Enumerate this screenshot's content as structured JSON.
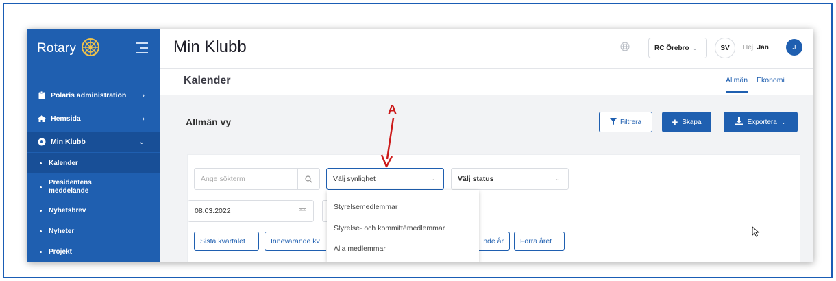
{
  "brand": {
    "name": "Rotary",
    "color": "#1f5fb0"
  },
  "sidebar": {
    "items": [
      {
        "label": "Polaris administration",
        "icon": "clipboard-icon",
        "arrow": "›"
      },
      {
        "label": "Hemsida",
        "icon": "home-icon",
        "arrow": "›"
      },
      {
        "label": "Min Klubb",
        "icon": "rotary-wheel-icon",
        "arrow": "⌄"
      }
    ],
    "subitems": [
      {
        "label": "Kalender"
      },
      {
        "label_line1": "Presidentens",
        "label_line2": "meddelande"
      },
      {
        "label": "Nyhetsbrev"
      },
      {
        "label": "Nyheter"
      },
      {
        "label": "Projekt"
      }
    ]
  },
  "header": {
    "title": "Min Klubb",
    "club": "RC Örebro",
    "language": "SV",
    "greeting_prefix": "Hej,",
    "user_name": "Jan",
    "avatar_initial": "J"
  },
  "page": {
    "title": "Kalender",
    "tabs": [
      "Allmän",
      "Ekonomi"
    ],
    "view_title": "Allmän vy"
  },
  "toolbar": {
    "filter_label": "Filtrera",
    "create_label": "Skapa",
    "export_label": "Exportera"
  },
  "filters": {
    "search_placeholder": "Ange sökterm",
    "visibility_placeholder": "Välj synlighet",
    "status_placeholder": "Välj status",
    "date_value": "08.03.2022"
  },
  "visibility_options": [
    "Styrelsemedlemmar",
    "Styrelse- och kommittémedlemmar",
    "Alla medlemmar"
  ],
  "period_buttons": [
    "Sista kvartalet",
    "Innevarande kv",
    "nde år",
    "Förra året"
  ],
  "annotation": {
    "label": "A",
    "color": "#cc1a1a"
  }
}
